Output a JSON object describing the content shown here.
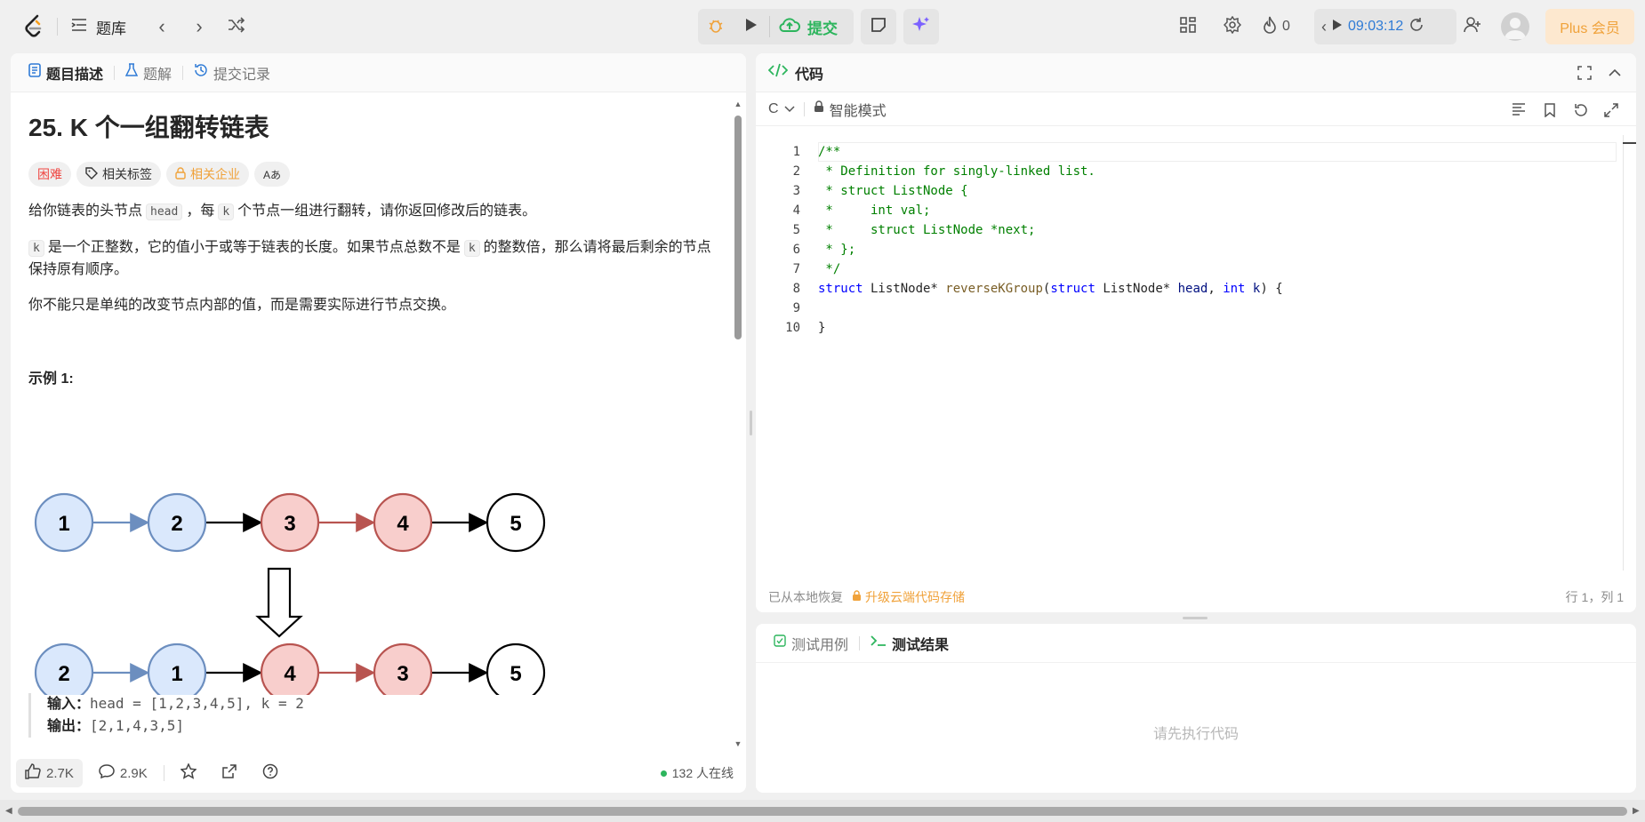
{
  "topbar": {
    "problem_list_label": "题库",
    "submit_label": "提交",
    "streak_count": "0",
    "timer": "09:03:12",
    "plus_label": "Plus 会员"
  },
  "left": {
    "tabs": [
      "题目描述",
      "题解",
      "提交记录"
    ],
    "title": "25. K 个一组翻转链表",
    "badges": {
      "difficulty": "困难",
      "tags": "相关标签",
      "company": "相关企业",
      "translate": "Aあ"
    },
    "p1_a": "给你链表的头节点",
    "p1_code1": "head",
    "p1_b": "，每",
    "p1_code2": "k",
    "p1_c": "个节点一组进行翻转，请你返回修改后的链表。",
    "p2_code1": "k",
    "p2_a": "是一个正整数，它的值小于或等于链表的长度。如果节点总数不是",
    "p2_code2": "k",
    "p2_b": "的整数倍，那么请将最后剩余的节点保持原有顺序。",
    "p3": "你不能只是单纯的改变节点内部的值，而是需要实际进行节点交换。",
    "example_title": "示例 1:",
    "diagram": {
      "before": [
        "1",
        "2",
        "3",
        "4",
        "5"
      ],
      "after": [
        "2",
        "1",
        "4",
        "3",
        "5"
      ],
      "colors": {
        "blue_fill": "#dae8fc",
        "blue_stroke": "#6c8ebf",
        "red_fill": "#f8cecc",
        "red_stroke": "#b85450",
        "white_fill": "#ffffff",
        "black": "#000000"
      }
    },
    "input_label": "输入：",
    "input_value": "head = [1,2,3,4,5], k = 2",
    "output_label": "输出：",
    "output_value": "[2,1,4,3,5]",
    "likes": "2.7K",
    "comments": "2.9K",
    "online": "132 人在线"
  },
  "code": {
    "header": "代码",
    "language": "C",
    "mode": "智能模式",
    "lines": [
      {
        "n": "1",
        "t": "/**"
      },
      {
        "n": "2",
        "t": " * Definition for singly-linked list."
      },
      {
        "n": "3",
        "t": " * struct ListNode {"
      },
      {
        "n": "4",
        "t": " *     int val;"
      },
      {
        "n": "5",
        "t": " *     struct ListNode *next;"
      },
      {
        "n": "6",
        "t": " * };"
      },
      {
        "n": "7",
        "t": " */"
      },
      {
        "n": "8",
        "t": "struct ListNode* reverseKGroup(struct ListNode* head, int k) {"
      },
      {
        "n": "9",
        "t": ""
      },
      {
        "n": "10",
        "t": "}"
      }
    ],
    "restored": "已从本地恢复",
    "cloud_upgrade": "升级云端代码存储",
    "cursor": "行 1，列 1"
  },
  "test": {
    "tab_cases": "测试用例",
    "tab_results": "测试结果",
    "empty": "请先执行代码"
  }
}
